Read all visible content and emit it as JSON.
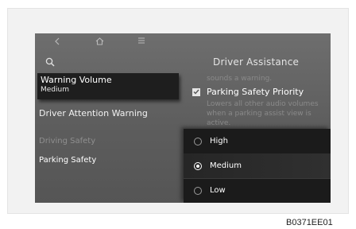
{
  "screen": {
    "title": "Driver Assistance",
    "icons": [
      "back-icon",
      "home-icon",
      "menu-icon",
      "search-icon"
    ]
  },
  "popup": {
    "label": "Warning Volume",
    "value": "Medium"
  },
  "left_menu": {
    "items": [
      {
        "label": "Driver Attention Warning"
      },
      {
        "label": "Driving Safety"
      },
      {
        "label": "Parking Safety"
      }
    ]
  },
  "right_panel": {
    "faint_top": "sounds a warning.",
    "checkbox_label": "Parking Safety Priority",
    "checkbox_checked": true,
    "description": [
      "Lowers all other audio volumes",
      "when a parking assist view is",
      "active."
    ]
  },
  "dropdown": {
    "options": [
      {
        "label": "High",
        "selected": false
      },
      {
        "label": "Medium",
        "selected": true
      },
      {
        "label": "Low",
        "selected": false
      }
    ]
  },
  "figure_code": "B0371EE01"
}
